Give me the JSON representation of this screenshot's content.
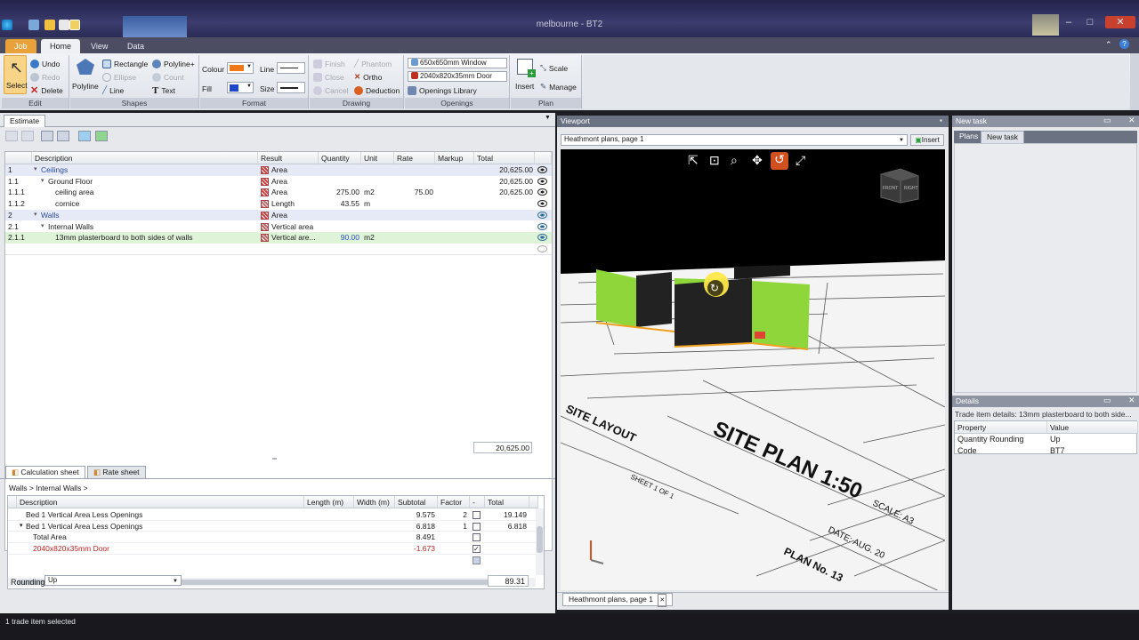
{
  "window": {
    "title": "melbourne - BT2",
    "min": "–",
    "max": "□",
    "close": "✕"
  },
  "ribbon_tabs": {
    "job": "Job",
    "home": "Home",
    "view": "View",
    "data": "Data"
  },
  "ribbon": {
    "edit": {
      "select": "Select",
      "undo": "Undo",
      "redo": "Redo",
      "delete": "Delete",
      "label": "Edit"
    },
    "shapes": {
      "polyline": "Polyline",
      "rectangle": "Rectangle",
      "ellipse": "Ellipse",
      "line": "Line",
      "polyline_plus": "Polyline+",
      "count": "Count",
      "text": "Text",
      "label": "Shapes"
    },
    "format": {
      "colour": "Colour",
      "fill": "Fill",
      "line": "Line",
      "size": "Size",
      "label": "Format",
      "colour_hex": "#f07818",
      "fill_hex": "#2046c8"
    },
    "drawing": {
      "finish": "Finish",
      "close": "Close",
      "cancel": "Cancel",
      "phantom": "Phantom",
      "ortho": "Ortho",
      "deduction": "Deduction",
      "label": "Drawing"
    },
    "openings": {
      "window": "650x650mm Window",
      "door": "2040x820x35mm Door",
      "library": "Openings Library",
      "label": "Openings"
    },
    "plan": {
      "insert": "Insert",
      "scale": "Scale",
      "manage": "Manage",
      "label": "Plan"
    }
  },
  "estimate": {
    "tab": "Estimate",
    "columns": [
      "Description",
      "Result",
      "Quantity",
      "Unit",
      "Rate",
      "Markup",
      "Total"
    ],
    "rows": [
      {
        "id": "1",
        "desc": "Ceilings",
        "result": "Area",
        "qty": "",
        "unit": "",
        "rate": "",
        "markup": "",
        "total": "20,625.00"
      },
      {
        "id": "1.1",
        "desc": "Ground Floor",
        "result": "Area",
        "qty": "",
        "unit": "",
        "rate": "",
        "markup": "",
        "total": "20,625.00"
      },
      {
        "id": "1.1.1",
        "desc": "ceiling area",
        "result": "Area",
        "qty": "275.00",
        "unit": "m2",
        "rate": "75.00",
        "markup": "",
        "total": "20,625.00"
      },
      {
        "id": "1.1.2",
        "desc": "cornice",
        "result": "Length",
        "qty": "43.55",
        "unit": "m",
        "rate": "",
        "markup": "",
        "total": ""
      },
      {
        "id": "2",
        "desc": "Walls",
        "result": "Area",
        "qty": "",
        "unit": "",
        "rate": "",
        "markup": "",
        "total": ""
      },
      {
        "id": "2.1",
        "desc": "Internal Walls",
        "result": "Vertical area",
        "qty": "",
        "unit": "",
        "rate": "",
        "markup": "",
        "total": ""
      },
      {
        "id": "2.1.1",
        "desc": "13mm plasterboard to both sides of walls",
        "result": "Vertical are...",
        "qty": "90.00",
        "unit": "m2",
        "rate": "",
        "markup": "",
        "total": ""
      }
    ],
    "grand_total": "20,625.00"
  },
  "calc": {
    "tab_calc": "Calculation sheet",
    "tab_rate": "Rate sheet",
    "breadcrumb": "Walls > Internal Walls >",
    "columns": [
      "Description",
      "Length (m)",
      "Width (m)",
      "Subtotal",
      "Factor",
      "-",
      "Total"
    ],
    "rows": [
      {
        "desc": "Bed 1 Vertical Area Less Openings",
        "subtotal": "9.575",
        "factor": "2",
        "total": "19.149"
      },
      {
        "desc": "Bed 1 Vertical Area Less Openings",
        "subtotal": "6.818",
        "factor": "1",
        "total": "6.818"
      },
      {
        "desc": "Total Area",
        "subtotal": "8.491",
        "factor": "",
        "total": ""
      },
      {
        "desc": "2040x820x35mm Door",
        "subtotal": "-1.673",
        "factor": "",
        "total": ""
      }
    ],
    "rounding_label": "Rounding",
    "rounding_value": "Up",
    "rounding_total": "89.31"
  },
  "viewport": {
    "title": "Viewport",
    "select": "Heathmont plans, page 1",
    "insert": "Insert",
    "bottom_tab": "Heathmont plans, page 1",
    "close": "✕",
    "cube_front": "FRONT",
    "cube_right": "RIGHT",
    "plan_text": "SITE PLAN 1:50",
    "plan_sheet": "SHEET 1 OF 1",
    "plan_scale": "SCALE: A3",
    "plan_date": "DATE: AUG. 20",
    "plan_no": "PLAN No. 13",
    "plan_site": "SITE LAYOUT"
  },
  "new_task": {
    "title": "New task",
    "tab_plans": "Plans",
    "tab_new": "New task"
  },
  "details": {
    "title": "Details",
    "subtitle": "Trade item details: 13mm plasterboard to both side...",
    "col_property": "Property",
    "col_value": "Value",
    "rows": [
      {
        "p": "Quantity Rounding",
        "v": "Up"
      },
      {
        "p": "Code",
        "v": "BT7"
      }
    ]
  },
  "status": {
    "text": "1 trade item selected"
  }
}
